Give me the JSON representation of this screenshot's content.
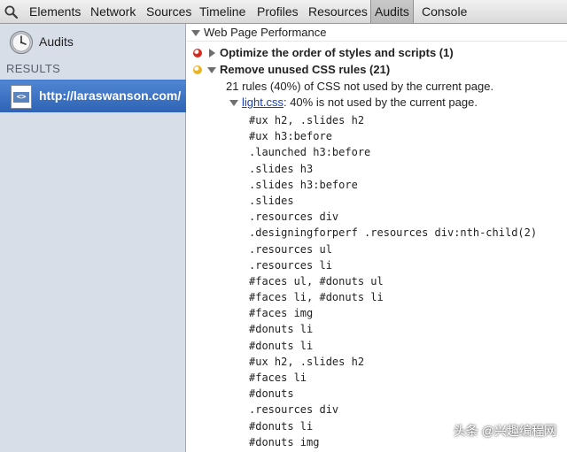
{
  "toolbar": {
    "search_icon": "magnifier-icon",
    "tabs": [
      "Elements",
      "Network",
      "Sources",
      "Timeline",
      "Profiles",
      "Resources",
      "Audits",
      "Console"
    ],
    "active_tab": "Audits"
  },
  "sidebar": {
    "audits_label": "Audits",
    "results_label": "RESULTS",
    "site_label": "http://laraswanson.com/"
  },
  "main": {
    "category_title": "Web Page Performance",
    "rules": [
      {
        "title": "Optimize the order of styles and scripts (1)",
        "severity_color": "#d42a1d",
        "expanded": false
      },
      {
        "title": "Remove unused CSS rules (21)",
        "severity_color": "#e9b425",
        "expanded": true
      }
    ],
    "rule_description": "21 rules (40%) of CSS not used by the current page.",
    "file": {
      "name": "light.css",
      "rest": ": 40% is not used by the current page."
    },
    "selectors": [
      "#ux h2, .slides h2",
      "#ux h3:before",
      ".launched h3:before",
      ".slides h3",
      ".slides h3:before",
      ".slides",
      ".resources div",
      ".designingforperf .resources div:nth-child(2)",
      ".resources ul",
      ".resources li",
      "#faces ul, #donuts ul",
      "#faces li, #donuts li",
      "#faces img",
      "#donuts li",
      "#donuts li",
      "#ux h2, .slides h2",
      "#faces li",
      "#donuts",
      ".resources div",
      "#donuts li",
      "#donuts img"
    ]
  },
  "watermark": "头条 @兴趣编程网"
}
